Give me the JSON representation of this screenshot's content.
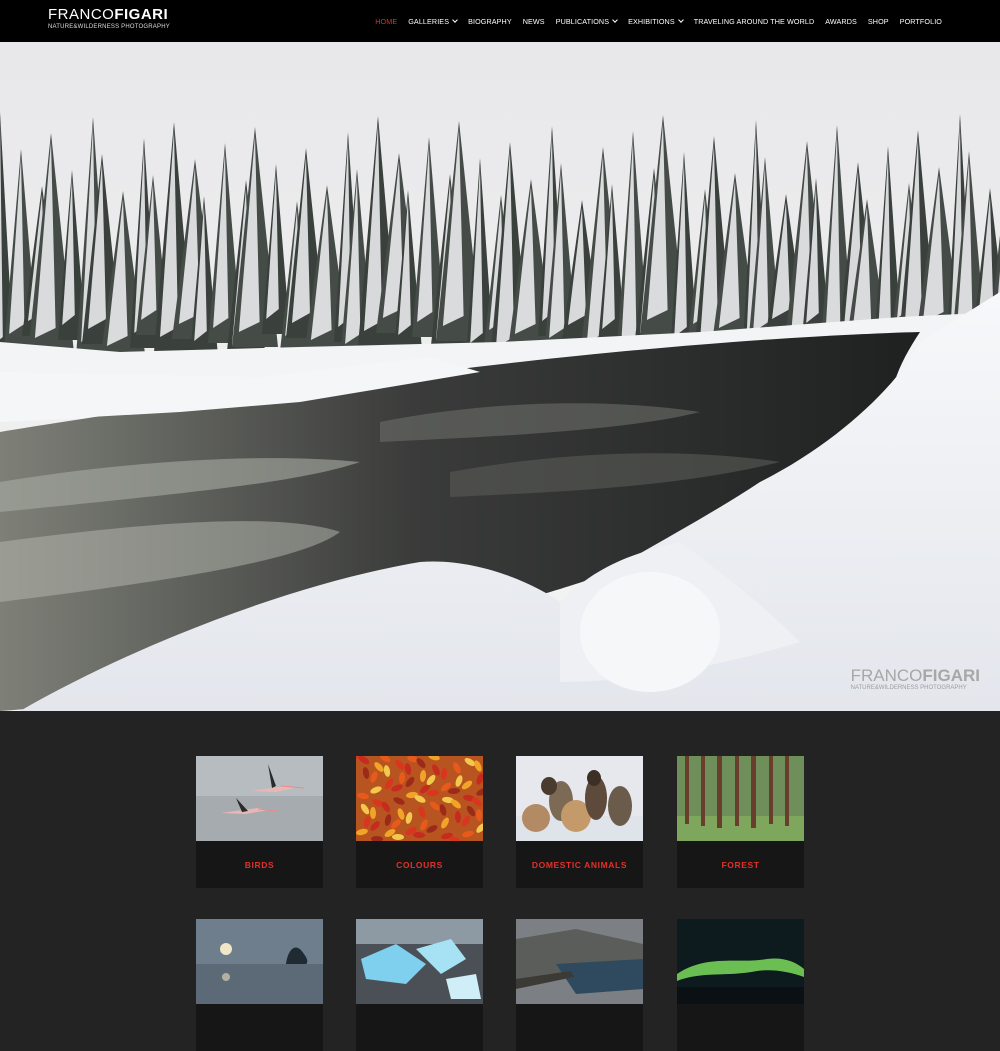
{
  "site": {
    "logo_part1": "FRANCO",
    "logo_part2": "FIGARI",
    "tagline": "NATURE&WILDERNESS PHOTOGRAPHY"
  },
  "nav": {
    "items": [
      {
        "label": "HOME",
        "active": true,
        "dropdown": false
      },
      {
        "label": "GALLERIES",
        "active": false,
        "dropdown": true
      },
      {
        "label": "BIOGRAPHY",
        "active": false,
        "dropdown": false
      },
      {
        "label": "NEWS",
        "active": false,
        "dropdown": false
      },
      {
        "label": "PUBLICATIONS",
        "active": false,
        "dropdown": true
      },
      {
        "label": "EXHIBITIONS",
        "active": false,
        "dropdown": true
      },
      {
        "label": "TRAVELING AROUND THE WORLD",
        "active": false,
        "dropdown": false
      },
      {
        "label": "AWARDS",
        "active": false,
        "dropdown": false
      },
      {
        "label": "SHOP",
        "active": false,
        "dropdown": false
      },
      {
        "label": "PORTFOLIO",
        "active": false,
        "dropdown": false
      }
    ]
  },
  "hero": {
    "watermark_part1": "FRANCO",
    "watermark_part2": "FIGARI",
    "watermark_tagline": "NATURE&WILDERNESS PHOTOGRAPHY"
  },
  "galleries": [
    {
      "label": "BIRDS"
    },
    {
      "label": "COLOURS"
    },
    {
      "label": "DOMESTIC ANIMALS"
    },
    {
      "label": "FOREST"
    },
    {
      "label": ""
    },
    {
      "label": ""
    },
    {
      "label": ""
    },
    {
      "label": ""
    }
  ],
  "colors": {
    "accent": "#e2302b",
    "header_bg": "#000000",
    "page_bg": "#232323",
    "card_bg": "#161616"
  }
}
